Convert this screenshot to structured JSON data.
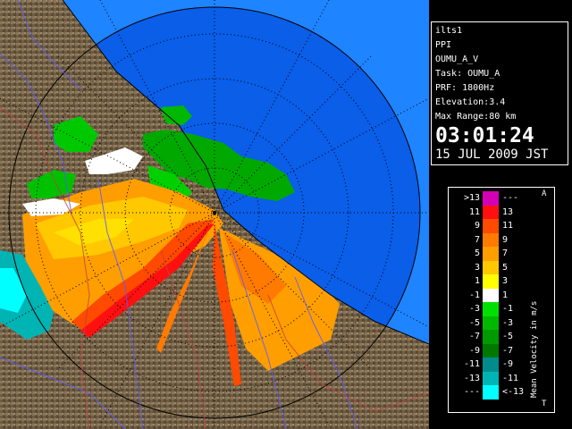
{
  "info": {
    "lines": [
      "ilts1",
      "PPI",
      "OUMU_A_V",
      "Task: OUMU_A",
      "PRF: 1800Hz",
      "Elevation:3.4",
      "Max Range:80 km"
    ],
    "time": "03:01:24",
    "date": "15 JUL 2009 JST"
  },
  "legend": {
    "title": "Mean Velocity in m/s",
    "top_marker": "A",
    "bottom_marker": "T",
    "rows": [
      {
        "left": ">13",
        "right": "---",
        "color": "#d400b4"
      },
      {
        "left": "11",
        "right": "13",
        "color": "#ff1010"
      },
      {
        "left": "9",
        "right": "11",
        "color": "#ff4a00"
      },
      {
        "left": "7",
        "right": "9",
        "color": "#ff7a00"
      },
      {
        "left": "5",
        "right": "7",
        "color": "#ff9e00"
      },
      {
        "left": "3",
        "right": "5",
        "color": "#ffc800"
      },
      {
        "left": "1",
        "right": "3",
        "color": "#ffff00"
      },
      {
        "left": "-1",
        "right": "1",
        "color": "#ffffff"
      },
      {
        "left": "-3",
        "right": "-1",
        "color": "#00e000"
      },
      {
        "left": "-5",
        "right": "-3",
        "color": "#00b800"
      },
      {
        "left": "-7",
        "right": "-5",
        "color": "#009a00"
      },
      {
        "left": "-9",
        "right": "-7",
        "color": "#007800"
      },
      {
        "left": "-11",
        "right": "-9",
        "color": "#008c8c"
      },
      {
        "left": "-13",
        "right": "-11",
        "color": "#00b4b4"
      },
      {
        "left": "---",
        "right": "<-13",
        "color": "#00ffff"
      }
    ]
  },
  "map": {
    "sea_color": "#0a5ee8",
    "outer_color": "#1e84ff",
    "land_color": "#7a6a52"
  }
}
